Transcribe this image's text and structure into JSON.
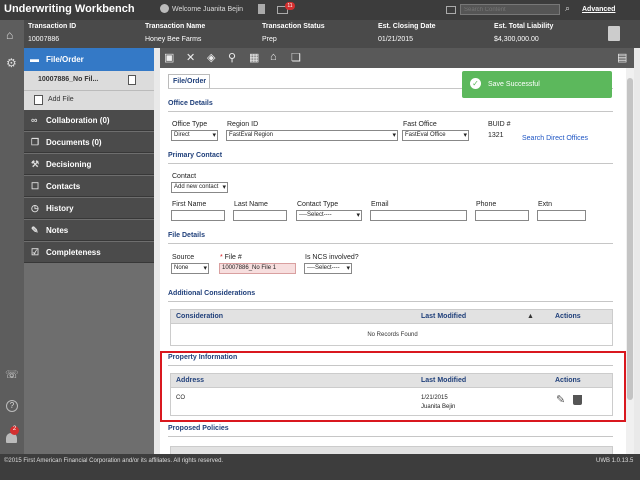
{
  "app": {
    "title": "Underwriting Workbench",
    "welcome": "Welcome Juanita Bejin",
    "search_placeholder": "Search Content",
    "advanced": "Advanced",
    "notif_count": "11"
  },
  "transaction": {
    "headers": [
      "Transaction ID",
      "Transaction Name",
      "Transaction Status",
      "Est. Closing Date",
      "Est. Total Liability"
    ],
    "values": [
      "10007886",
      "Honey Bee Farms",
      "Prep",
      "01/21/2015",
      "$4,300,000.00"
    ]
  },
  "nav": {
    "file_order": "File/Order",
    "file_item": "10007886_No Fil...",
    "add_file": "Add File",
    "items": [
      "Collaboration (0)",
      "Documents (0)",
      "Decisioning",
      "Contacts",
      "History",
      "Notes",
      "Completeness"
    ]
  },
  "rail": {
    "badge": "2"
  },
  "tab": "File/Order",
  "toast": "Save Successful",
  "office": {
    "section": "Office Details",
    "office_type_label": "Office Type",
    "office_type_value": "Direct",
    "region_label": "Region ID",
    "region_value": "FastEval Region",
    "fast_office_label": "Fast Office",
    "fast_office_value": "FastEval Office",
    "buid_label": "BUID #",
    "buid_value": "1321",
    "search_link": "Search Direct Offices"
  },
  "contact": {
    "section": "Primary Contact",
    "contact_label": "Contact",
    "contact_value": "Add new contact",
    "fields": [
      "First Name",
      "Last Name",
      "Contact Type",
      "Email",
      "Phone",
      "Extn"
    ],
    "contact_type_value": "----Select----"
  },
  "file": {
    "section": "File Details",
    "source_label": "Source",
    "source_value": "None",
    "file_label": "File #",
    "file_value": "10007886_No File 1",
    "ncs_label": "Is NCS involved?",
    "ncs_value": "----Select----"
  },
  "additional": {
    "section": "Additional Considerations",
    "headers": [
      "Consideration",
      "Last Modified",
      "Actions"
    ],
    "empty": "No Records Found"
  },
  "property": {
    "section": "Property Information",
    "headers": [
      "Address",
      "Last Modified",
      "Actions"
    ],
    "row": {
      "address": "CO",
      "date": "1/21/2015",
      "user": "Juanita Bejin"
    }
  },
  "proposed": {
    "section": "Proposed Policies"
  },
  "footer": {
    "copyright": "©2015 First American Financial Corporation and/or its affiliates. All rights reserved.",
    "version": "UWB 1.0.13.5"
  },
  "colors": {
    "accent": "#1f3f7a",
    "toast": "#5cb85c",
    "highlight": "#d9181f"
  }
}
